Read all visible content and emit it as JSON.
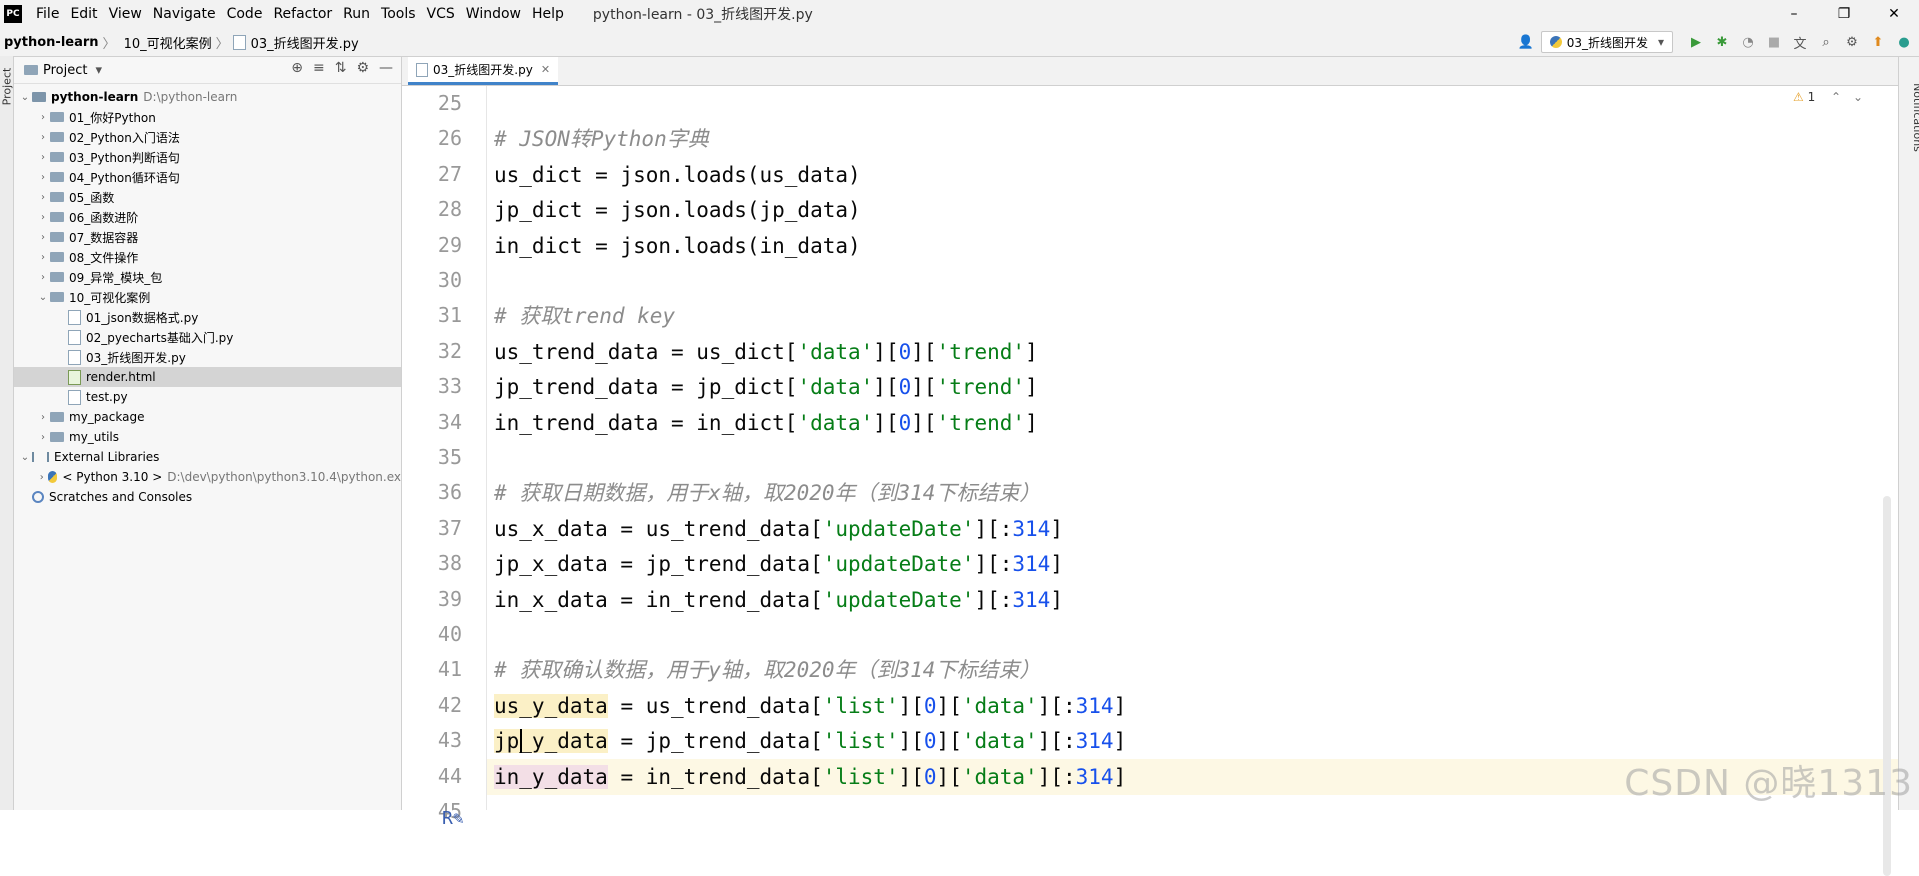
{
  "menubar": {
    "logo": "PC",
    "items": [
      "File",
      "Edit",
      "View",
      "Navigate",
      "Code",
      "Refactor",
      "Run",
      "Tools",
      "VCS",
      "Window",
      "Help"
    ],
    "title": "python-learn - 03_折线图开发.py"
  },
  "window_controls": {
    "minimize": "–",
    "restore": "❐",
    "close": "✕"
  },
  "breadcrumb": {
    "project": "python-learn",
    "folder": "10_可视化案例",
    "file": "03_折线图开发.py"
  },
  "toolbar": {
    "run_config": "03_折线图开发"
  },
  "left_strip": {
    "label": "Project"
  },
  "project_panel": {
    "title": "Project",
    "tree": [
      {
        "label": "python-learn",
        "path": "D:\\python-learn",
        "type": "root",
        "indent": 0,
        "open": true
      },
      {
        "label": "01_你好Python",
        "type": "folder",
        "indent": 1
      },
      {
        "label": "02_Python入门语法",
        "type": "folder",
        "indent": 1
      },
      {
        "label": "03_Python判断语句",
        "type": "folder",
        "indent": 1
      },
      {
        "label": "04_Python循环语句",
        "type": "folder",
        "indent": 1
      },
      {
        "label": "05_函数",
        "type": "folder",
        "indent": 1
      },
      {
        "label": "06_函数进阶",
        "type": "folder",
        "indent": 1
      },
      {
        "label": "07_数据容器",
        "type": "folder",
        "indent": 1
      },
      {
        "label": "08_文件操作",
        "type": "folder",
        "indent": 1
      },
      {
        "label": "09_异常_模块_包",
        "type": "folder",
        "indent": 1
      },
      {
        "label": "10_可视化案例",
        "type": "folder",
        "indent": 1,
        "open": true
      },
      {
        "label": "01_json数据格式.py",
        "type": "py",
        "indent": 2
      },
      {
        "label": "02_pyecharts基础入门.py",
        "type": "py",
        "indent": 2
      },
      {
        "label": "03_折线图开发.py",
        "type": "py",
        "indent": 2
      },
      {
        "label": "render.html",
        "type": "html",
        "indent": 2,
        "selected": true
      },
      {
        "label": "test.py",
        "type": "py",
        "indent": 2
      },
      {
        "label": "my_package",
        "type": "folder",
        "indent": 1
      },
      {
        "label": "my_utils",
        "type": "folder",
        "indent": 1
      },
      {
        "label": "External Libraries",
        "type": "lib",
        "indent": 0,
        "open": true
      },
      {
        "label": "< Python 3.10 >",
        "path": "D:\\dev\\python\\python3.10.4\\python.ex",
        "type": "python",
        "indent": 1
      },
      {
        "label": "Scratches and Consoles",
        "type": "scratch",
        "indent": 0
      }
    ]
  },
  "tab": {
    "label": "03_折线图开发.py"
  },
  "editor": {
    "warning_count": "1",
    "line_numbers": [
      "25",
      "26",
      "27",
      "28",
      "29",
      "30",
      "31",
      "32",
      "33",
      "34",
      "35",
      "36",
      "37",
      "38",
      "39",
      "40",
      "41",
      "42",
      "43",
      "44",
      "45"
    ],
    "lines": [
      [],
      [
        [
          "comment",
          "# JSON转Python字典"
        ]
      ],
      [
        [
          "plain",
          "us_dict = json.loads(us_data)"
        ]
      ],
      [
        [
          "plain",
          "jp_dict = json.loads(jp_data)"
        ]
      ],
      [
        [
          "plain",
          "in_dict = json.loads(in_data)"
        ]
      ],
      [],
      [
        [
          "comment",
          "# 获取trend key"
        ]
      ],
      [
        [
          "plain",
          "us_trend_data = us_dict["
        ],
        [
          "str",
          "'data'"
        ],
        [
          "plain",
          "]["
        ],
        [
          "num",
          "0"
        ],
        [
          "plain",
          "]["
        ],
        [
          "str",
          "'trend'"
        ],
        [
          "plain",
          "]"
        ]
      ],
      [
        [
          "plain",
          "jp_trend_data = jp_dict["
        ],
        [
          "str",
          "'data'"
        ],
        [
          "plain",
          "]["
        ],
        [
          "num",
          "0"
        ],
        [
          "plain",
          "]["
        ],
        [
          "str",
          "'trend'"
        ],
        [
          "plain",
          "]"
        ]
      ],
      [
        [
          "plain",
          "in_trend_data = in_dict["
        ],
        [
          "str",
          "'data'"
        ],
        [
          "plain",
          "]["
        ],
        [
          "num",
          "0"
        ],
        [
          "plain",
          "]["
        ],
        [
          "str",
          "'trend'"
        ],
        [
          "plain",
          "]"
        ]
      ],
      [],
      [
        [
          "comment",
          "# 获取日期数据，用于x轴，取2020年（到314下标结束）"
        ]
      ],
      [
        [
          "plain",
          "us_x_data = us_trend_data["
        ],
        [
          "str",
          "'updateDate'"
        ],
        [
          "plain",
          "][:"
        ],
        [
          "num",
          "314"
        ],
        [
          "plain",
          "]"
        ]
      ],
      [
        [
          "plain",
          "jp_x_data = jp_trend_data["
        ],
        [
          "str",
          "'updateDate'"
        ],
        [
          "plain",
          "][:"
        ],
        [
          "num",
          "314"
        ],
        [
          "plain",
          "]"
        ]
      ],
      [
        [
          "plain",
          "in_x_data = in_trend_data["
        ],
        [
          "str",
          "'updateDate'"
        ],
        [
          "plain",
          "][:"
        ],
        [
          "num",
          "314"
        ],
        [
          "plain",
          "]"
        ]
      ],
      [],
      [
        [
          "comment",
          "# 获取确认数据，用于y轴，取2020年（到314下标结束）"
        ]
      ],
      [
        [
          "hlus",
          "us_y_data"
        ],
        [
          "plain",
          " = us_trend_data["
        ],
        [
          "str",
          "'list'"
        ],
        [
          "plain",
          "]["
        ],
        [
          "num",
          "0"
        ],
        [
          "plain",
          "]["
        ],
        [
          "str",
          "'data'"
        ],
        [
          "plain",
          "][:"
        ],
        [
          "num",
          "314"
        ],
        [
          "plain",
          "]"
        ]
      ],
      [
        [
          "hlus",
          "jp_y_data"
        ],
        [
          "plain",
          " = jp_trend_data["
        ],
        [
          "str",
          "'list'"
        ],
        [
          "plain",
          "]["
        ],
        [
          "num",
          "0"
        ],
        [
          "plain",
          "]["
        ],
        [
          "str",
          "'data'"
        ],
        [
          "plain",
          "][:"
        ],
        [
          "num",
          "314"
        ],
        [
          "plain",
          "]"
        ]
      ],
      [
        [
          "hl",
          "in_y_data"
        ],
        [
          "plain",
          " = in_trend_data["
        ],
        [
          "str",
          "'list'"
        ],
        [
          "plain",
          "]["
        ],
        [
          "num",
          "0"
        ],
        [
          "plain",
          "]["
        ],
        [
          "str",
          "'data'"
        ],
        [
          "plain",
          "][:"
        ],
        [
          "num",
          "314"
        ],
        [
          "plain",
          "]"
        ]
      ],
      []
    ]
  },
  "right_strip": {
    "label": "Notifications"
  },
  "watermark": "CSDN @晓1313"
}
